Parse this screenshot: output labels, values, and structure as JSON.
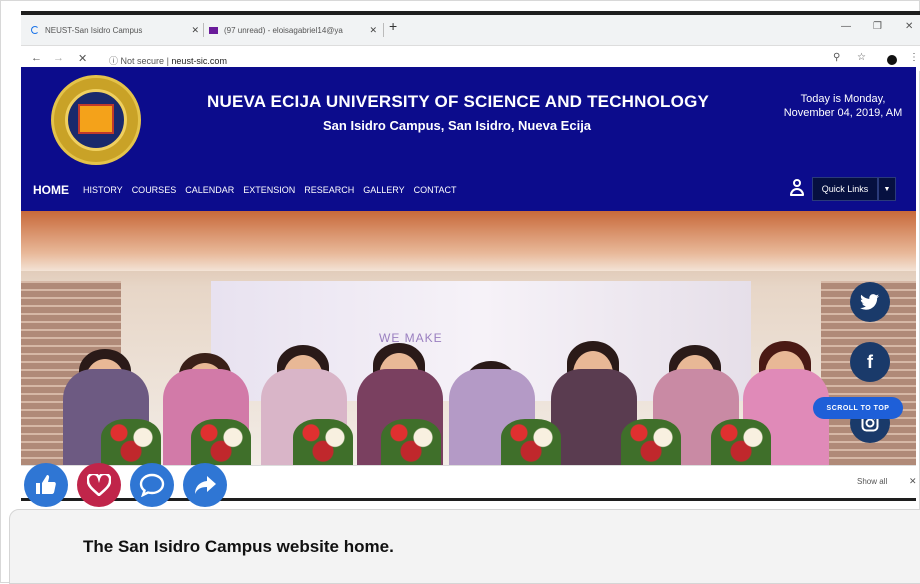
{
  "browser": {
    "tab1_title": "NEUST-San Isidro Campus",
    "tab2_title": "(97 unread) - eloisagabriel14@ya",
    "url_secure": "Not secure",
    "url": "neust-sic.com"
  },
  "site": {
    "title": "NUEVA ECIJA UNIVERSITY OF SCIENCE AND TECHNOLOGY",
    "subtitle": "San Isidro Campus, San Isidro, Nueva Ecija",
    "date": "Today is Monday, November 04, 2019, AM"
  },
  "menu": {
    "home": "HOME",
    "items": [
      "HISTORY",
      "COURSES",
      "CALENDAR",
      "EXTENSION",
      "RESEARCH",
      "GALLERY",
      "CONTACT"
    ],
    "quick_links": "Quick Links"
  },
  "hero": {
    "banner_text": "WE MAKE"
  },
  "floating": {
    "scroll_to_top": "SCROLL TO TOP",
    "twitter_icon": "twitter-icon",
    "facebook_icon": "facebook-icon",
    "instagram_icon": "instagram-icon"
  },
  "download_bar": {
    "show_all": "Show all"
  },
  "reactions": [
    "like-icon",
    "heart-icon",
    "comment-icon",
    "share-icon"
  ],
  "caption": "The San Isidro Campus website home.",
  "colors": {
    "header_bg": "#0c0c8c",
    "like_blue": "#2f76d4",
    "love_red": "#c0254a",
    "scroll_btn": "#1e5fd8"
  }
}
